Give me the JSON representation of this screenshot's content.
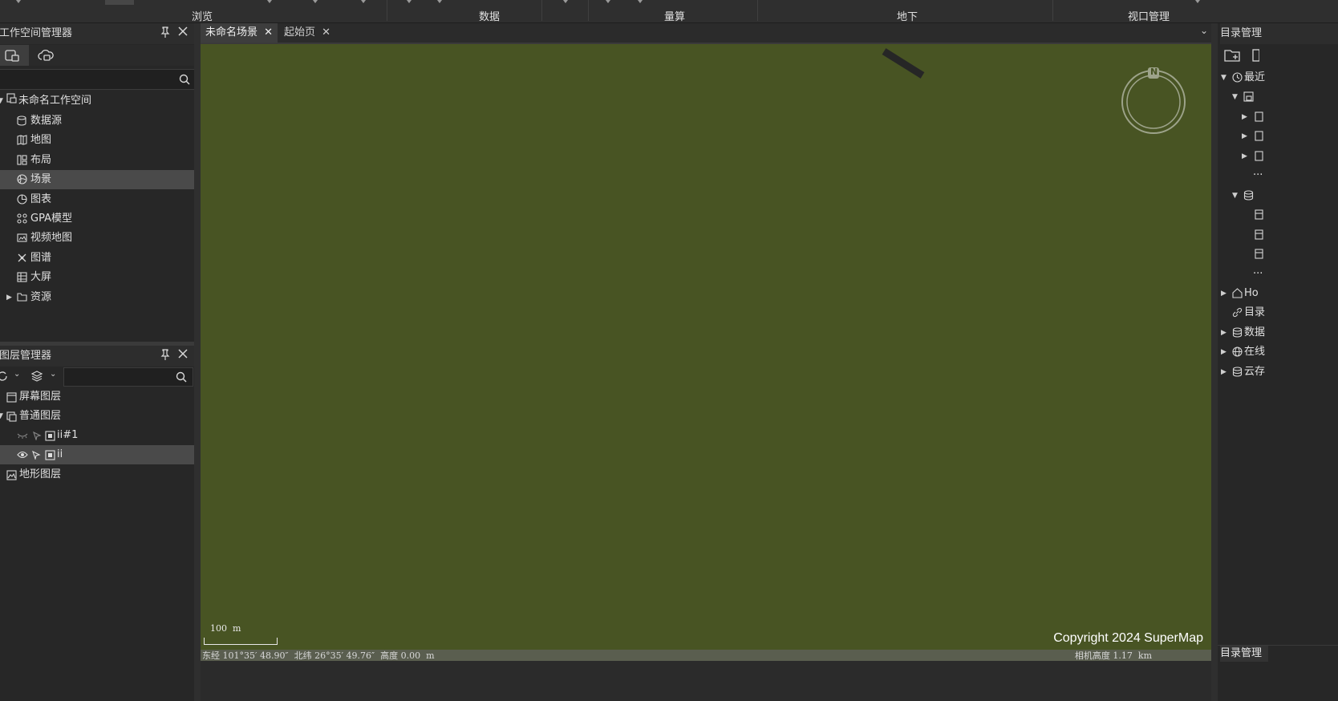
{
  "ribbon": {
    "groups": [
      "浏览",
      "数据",
      "量算",
      "地下",
      "视口管理"
    ]
  },
  "workspace_panel": {
    "title": "工作空间管理器",
    "pin_icon": "pin-icon",
    "close_icon": "close-icon",
    "tabs": [
      {
        "icon": "workspace-icon"
      },
      {
        "icon": "cloud-workspace-icon"
      }
    ],
    "search_placeholder": "",
    "root": "未命名工作空间",
    "items": [
      {
        "label": "数据源",
        "icon": "datasource-icon"
      },
      {
        "label": "地图",
        "icon": "map-icon"
      },
      {
        "label": "布局",
        "icon": "layout-icon"
      },
      {
        "label": "场景",
        "icon": "scene-icon",
        "selected": true
      },
      {
        "label": "图表",
        "icon": "chart-icon"
      },
      {
        "label": "GPA模型",
        "icon": "gpa-model-icon"
      },
      {
        "label": "视频地图",
        "icon": "video-map-icon"
      },
      {
        "label": "图谱",
        "icon": "graph-icon"
      },
      {
        "label": "大屏",
        "icon": "dashboard-icon"
      },
      {
        "label": "资源",
        "icon": "folder-icon",
        "expandable": true
      }
    ]
  },
  "layer_panel": {
    "title": "图层管理器",
    "search_placeholder": "",
    "items": [
      {
        "label": "屏幕图层",
        "icon": "screen-layer-icon",
        "level": 0
      },
      {
        "label": "普通图层",
        "icon": "normal-layer-icon",
        "level": 0,
        "expanded": true
      },
      {
        "label": "ii#1",
        "icon": "model-layer-icon",
        "level": 1,
        "visible": false
      },
      {
        "label": "ii",
        "icon": "model-layer-icon",
        "level": 1,
        "visible": true,
        "selected": true
      },
      {
        "label": "地形图层",
        "icon": "terrain-layer-icon",
        "level": 0
      }
    ]
  },
  "document_tabs": [
    {
      "label": "未命名场景",
      "active": true
    },
    {
      "label": "起始页",
      "active": false
    }
  ],
  "scene": {
    "background_color": "#485423",
    "compass_label": "N",
    "scale_label": "100  m",
    "copyright": "Copyright 2024 SuperMap",
    "status_left": "东经 101°35′ 48.90″  北纬 26°35′ 49.76″  高度 0.00  m",
    "status_right": "相机高度 1.17  km"
  },
  "catalog_panel": {
    "title": "目录管理",
    "bottom_tab": "目录管理",
    "items": [
      {
        "label": "最近",
        "icon": "clock-icon",
        "level": 0,
        "expanded": true
      },
      {
        "label": "",
        "icon": "workspace-file-icon",
        "level": 1,
        "expanded": true
      },
      {
        "label": "",
        "icon": "file-icon",
        "level": 2
      },
      {
        "label": "",
        "icon": "file-icon",
        "level": 2
      },
      {
        "label": "",
        "icon": "file-icon",
        "level": 2
      },
      {
        "label": "...",
        "icon": "",
        "level": 3
      },
      {
        "label": "",
        "icon": "database-icon",
        "level": 1,
        "expanded": true
      },
      {
        "label": "",
        "icon": "datasource-file-icon",
        "level": 2
      },
      {
        "label": "",
        "icon": "datasource-file-icon",
        "level": 2
      },
      {
        "label": "",
        "icon": "datasource-file-icon",
        "level": 2
      },
      {
        "label": "...",
        "icon": "",
        "level": 3
      },
      {
        "label": "Ho",
        "icon": "home-icon",
        "level": 0
      },
      {
        "label": "目录",
        "icon": "link-icon",
        "level": 0
      },
      {
        "label": "数据",
        "icon": "database-icon",
        "level": 0
      },
      {
        "label": "在线",
        "icon": "globe-icon",
        "level": 0
      },
      {
        "label": "云存",
        "icon": "database-icon",
        "level": 0
      }
    ]
  }
}
